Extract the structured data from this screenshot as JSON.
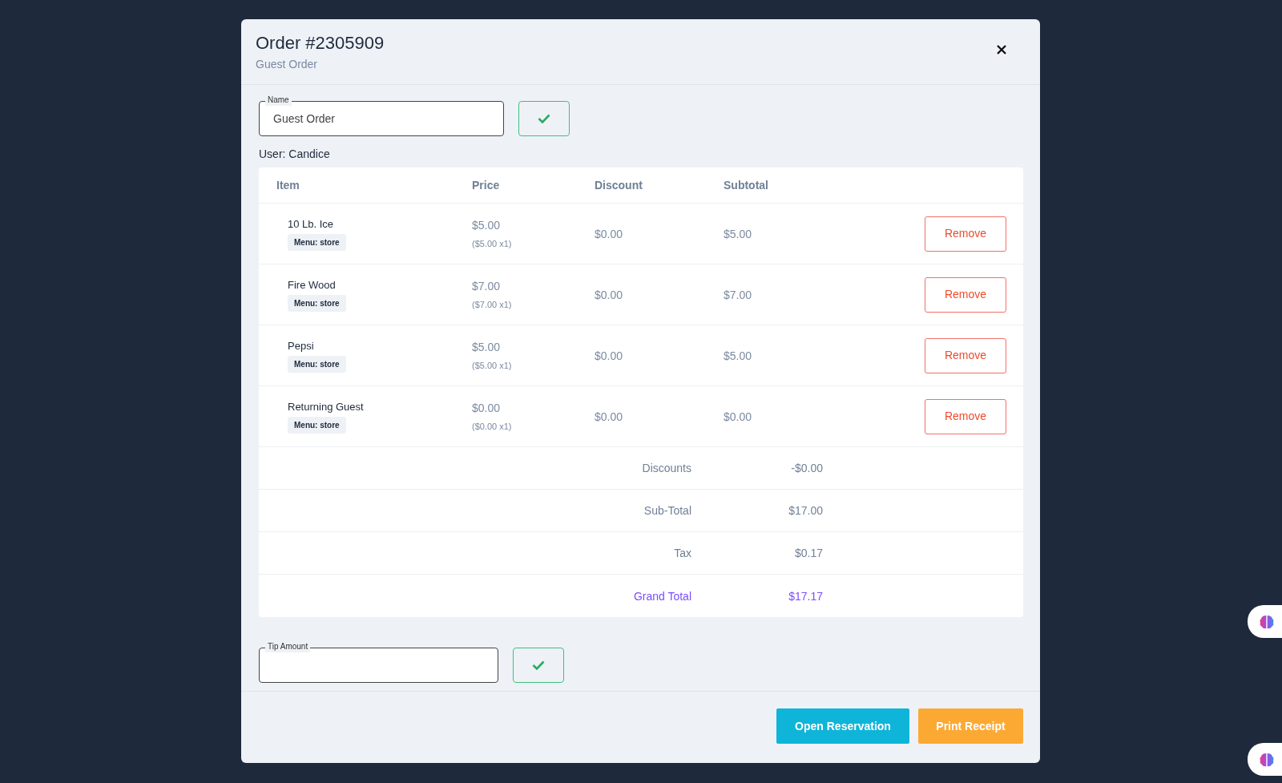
{
  "modal": {
    "title": "Order #2305909",
    "subtitle": "Guest Order"
  },
  "name_field": {
    "label": "Name",
    "value": "Guest Order"
  },
  "user": "User: Candice",
  "table": {
    "columns": [
      "Item",
      "Price",
      "Discount",
      "Subtotal"
    ],
    "rows": [
      {
        "item": "10 Lb. Ice",
        "tag": "Menu: store",
        "price": "$5.00",
        "unit": "($5.00 x1)",
        "discount": "$0.00",
        "subtotal": "$5.00",
        "action": "Remove"
      },
      {
        "item": "Fire Wood",
        "tag": "Menu: store",
        "price": "$7.00",
        "unit": "($7.00 x1)",
        "discount": "$0.00",
        "subtotal": "$7.00",
        "action": "Remove"
      },
      {
        "item": "Pepsi",
        "tag": "Menu: store",
        "price": "$5.00",
        "unit": "($5.00 x1)",
        "discount": "$0.00",
        "subtotal": "$5.00",
        "action": "Remove"
      },
      {
        "item": "Returning Guest",
        "tag": "Menu: store",
        "price": "$0.00",
        "unit": "($0.00 x1)",
        "discount": "$0.00",
        "subtotal": "$0.00",
        "action": "Remove"
      }
    ],
    "totals": [
      {
        "label": "Discounts",
        "value": "-$0.00",
        "kind": "normal"
      },
      {
        "label": "Sub-Total",
        "value": "$17.00",
        "kind": "normal"
      },
      {
        "label": "Tax",
        "value": "$0.17",
        "kind": "normal"
      },
      {
        "label": "Grand Total",
        "value": "$17.17",
        "kind": "grand"
      }
    ]
  },
  "tip_field": {
    "label": "Tip Amount"
  },
  "buttons": [
    {
      "label": "Open Reservation",
      "kind": "info"
    },
    {
      "label": "Print Receipt",
      "kind": "warning"
    }
  ]
}
